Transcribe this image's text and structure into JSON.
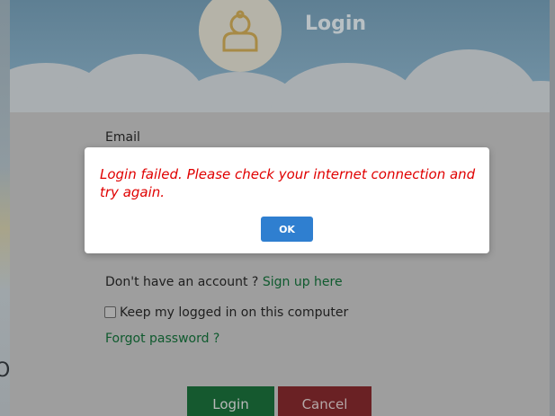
{
  "header": {
    "title": "Login",
    "avatar_icon": "user-icon"
  },
  "form": {
    "email_label": "Email",
    "signup_prompt": "Don't have an account ?",
    "signup_link": "Sign up here",
    "keep_logged_label": "Keep my logged in on this computer",
    "keep_logged_checked": false,
    "forgot_password_link": "Forgot password ?",
    "login_button": "Login",
    "cancel_button": "Cancel"
  },
  "modal": {
    "message": "Login failed. Please check your internet connection and try again.",
    "ok_button": "OK",
    "message_color": "#e00000",
    "ok_color": "#2f7fd0"
  },
  "colors": {
    "login_button": "#1e8a45",
    "cancel_button": "#c0393b",
    "link": "#1a7a3c"
  }
}
